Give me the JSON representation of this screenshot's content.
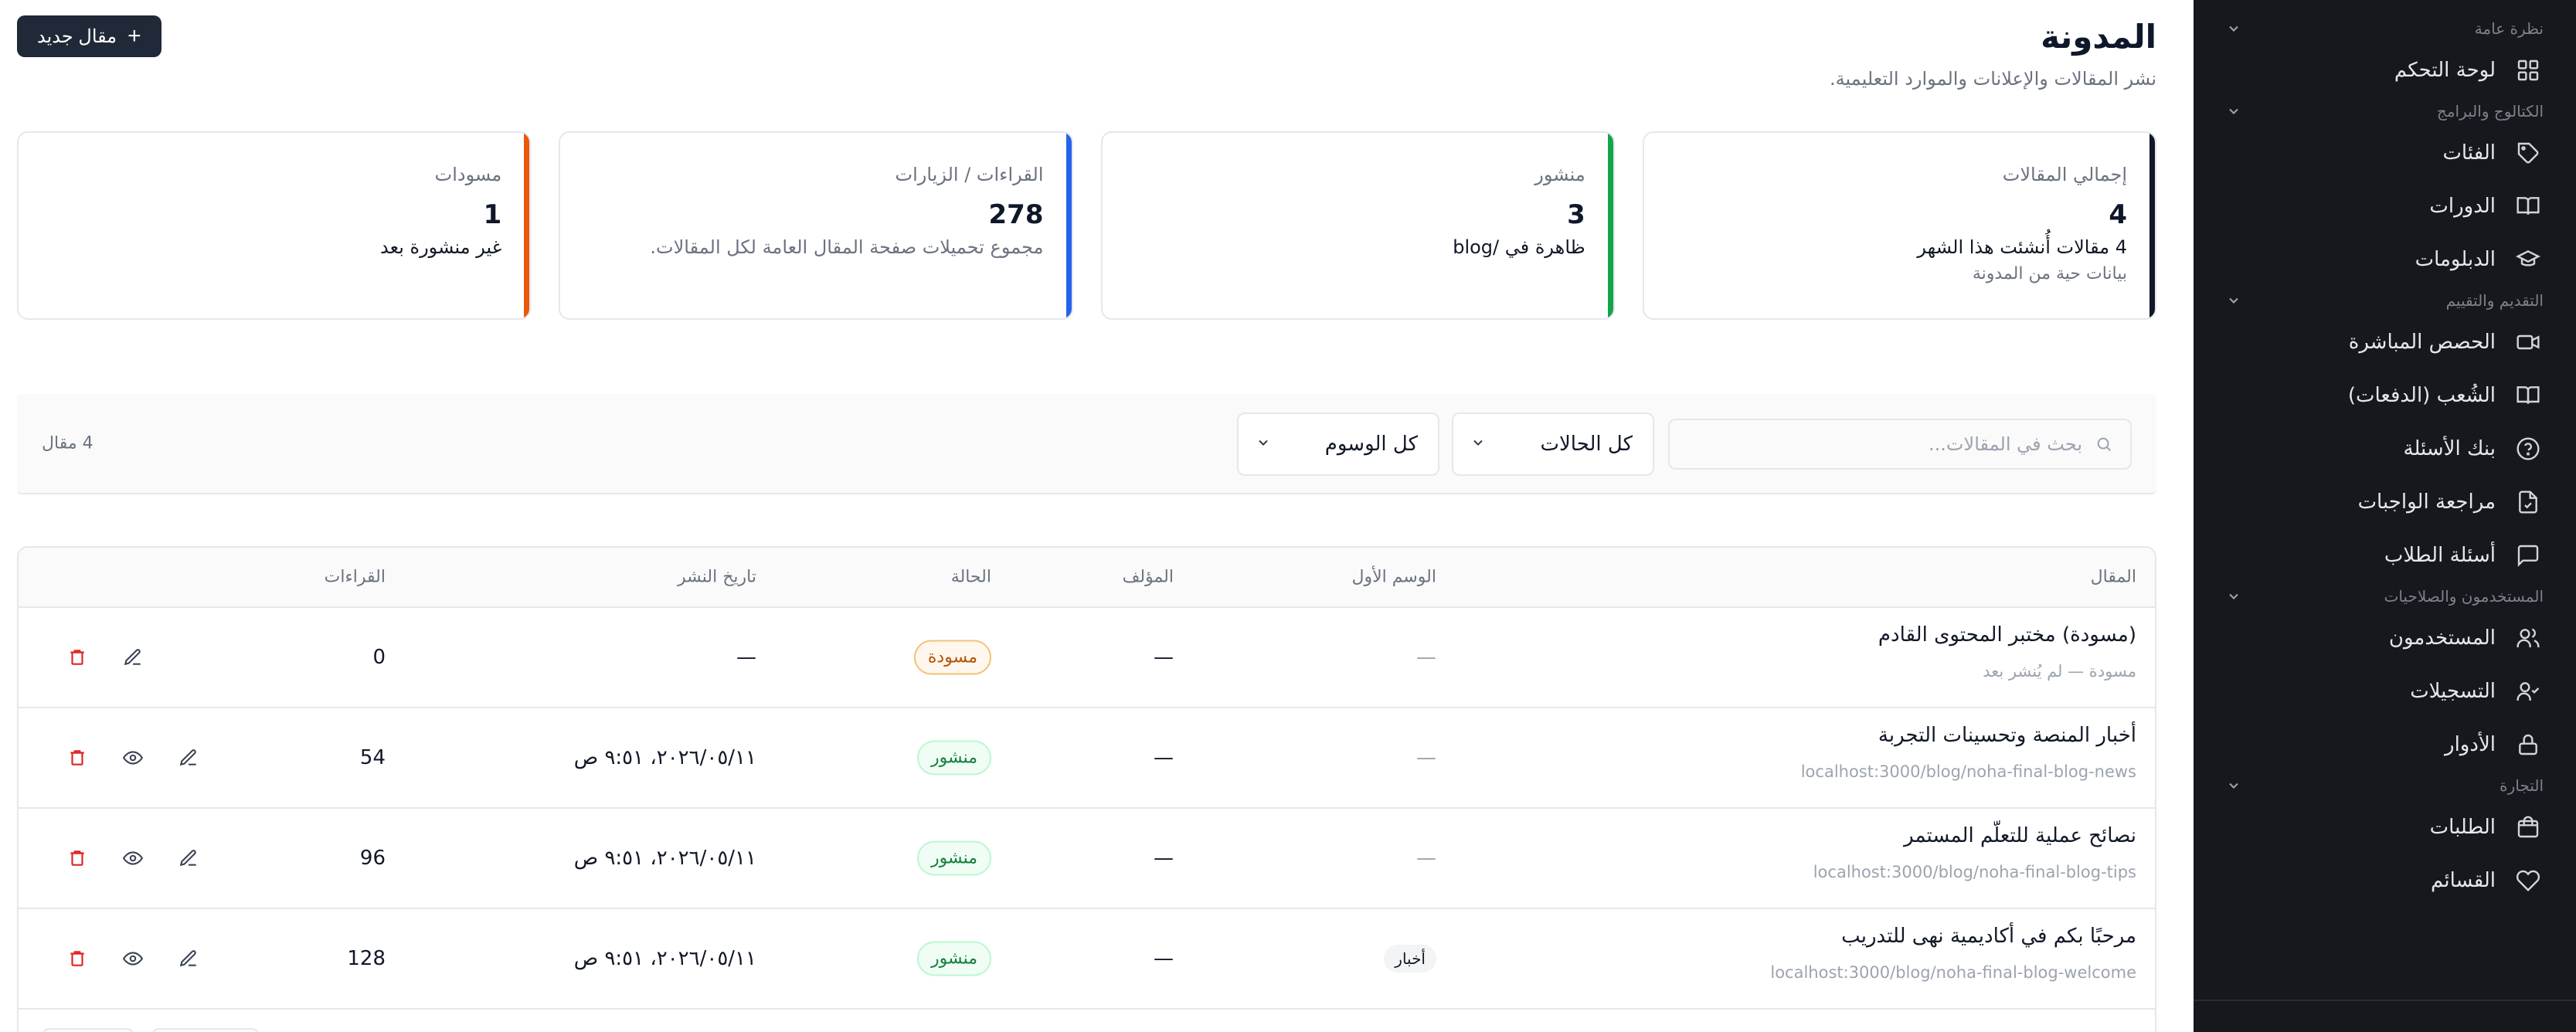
{
  "sidebar": {
    "groups": [
      {
        "title": "نظرة عامة",
        "items": [
          {
            "label": "لوحة التحكم",
            "icon": "grid-icon"
          }
        ]
      },
      {
        "title": "الكتالوج والبرامج",
        "items": [
          {
            "label": "الفئات",
            "icon": "tag-icon"
          },
          {
            "label": "الدورات",
            "icon": "book-icon"
          },
          {
            "label": "الدبلومات",
            "icon": "graduation-cap-icon"
          }
        ]
      },
      {
        "title": "التقديم والتقييم",
        "items": [
          {
            "label": "الحصص المباشرة",
            "icon": "video-icon"
          },
          {
            "label": "الشُعب (الدفعات)",
            "icon": "book-open-icon"
          },
          {
            "label": "بنك الأسئلة",
            "icon": "help-circle-icon"
          },
          {
            "label": "مراجعة الواجبات",
            "icon": "file-check-icon"
          },
          {
            "label": "أسئلة الطلاب",
            "icon": "message-square-icon"
          }
        ]
      },
      {
        "title": "المستخدمون والصلاحيات",
        "items": [
          {
            "label": "المستخدمون",
            "icon": "users-icon"
          },
          {
            "label": "التسجيلات",
            "icon": "user-check-icon"
          },
          {
            "label": "الأدوار",
            "icon": "lock-icon"
          }
        ]
      },
      {
        "title": "التجارة",
        "items": [
          {
            "label": "الطلبات",
            "icon": "shopping-bag-icon"
          },
          {
            "label": "القسائم",
            "icon": "heart-icon"
          }
        ]
      }
    ]
  },
  "header": {
    "title": "المدونة",
    "subtitle": "نشر المقالات والإعلانات والموارد التعليمية.",
    "new_button": "مقال جديد"
  },
  "stats": [
    {
      "label": "إجمالي المقالات",
      "value": "4",
      "desc": "4 مقالات أُنشئت هذا الشهر",
      "note": "بيانات حية من المدونة",
      "color": "#111827"
    },
    {
      "label": "منشور",
      "value": "3",
      "desc": "ظاهرة في /blog",
      "note": "",
      "color": "#16a34a"
    },
    {
      "label": "القراءات / الزيارات",
      "value": "278",
      "desc": "مجموع تحميلات صفحة المقال العامة لكل المقالات.",
      "note": "",
      "color": "#2563eb"
    },
    {
      "label": "مسودات",
      "value": "1",
      "desc": "غير منشورة بعد",
      "note": "",
      "color": "#ea580c"
    }
  ],
  "filters": {
    "search_placeholder": "بحث في المقالات...",
    "status": "كل الحالات",
    "tags": "كل الوسوم",
    "count": "4 مقال"
  },
  "table": {
    "headers": {
      "article": "المقال",
      "first_tag": "الوسم الأول",
      "author": "المؤلف",
      "status": "الحالة",
      "publish_date": "تاريخ النشر",
      "reads": "القراءات"
    },
    "rows": [
      {
        "title": "(مسودة) مختبر المحتوى القادم",
        "sub": "مسودة — لم يُنشر بعد",
        "tag": "—",
        "author": "—",
        "status": "مسودة",
        "status_kind": "draft",
        "date": "—",
        "reads": "0"
      },
      {
        "title": "أخبار المنصة وتحسينات التجربة",
        "sub": "localhost:3000/blog/noha-final-blog-news",
        "tag": "—",
        "author": "—",
        "status": "منشور",
        "status_kind": "pub",
        "date": "٢٠٢٦/٠٥/١١، ٩:٥١ ص",
        "reads": "54"
      },
      {
        "title": "نصائح عملية للتعلّم المستمر",
        "sub": "localhost:3000/blog/noha-final-blog-tips",
        "tag": "—",
        "author": "—",
        "status": "منشور",
        "status_kind": "pub",
        "date": "٢٠٢٦/٠٥/١١، ٩:٥١ ص",
        "reads": "96"
      },
      {
        "title": "مرحبًا بكم في أكاديمية نهى للتدريب",
        "sub": "localhost:3000/blog/noha-final-blog-welcome",
        "tag": "أخبار",
        "author": "—",
        "status": "منشور",
        "status_kind": "pub",
        "date": "٢٠٢٦/٠٥/١١، ٩:٥١ ص",
        "reads": "128"
      }
    ]
  }
}
